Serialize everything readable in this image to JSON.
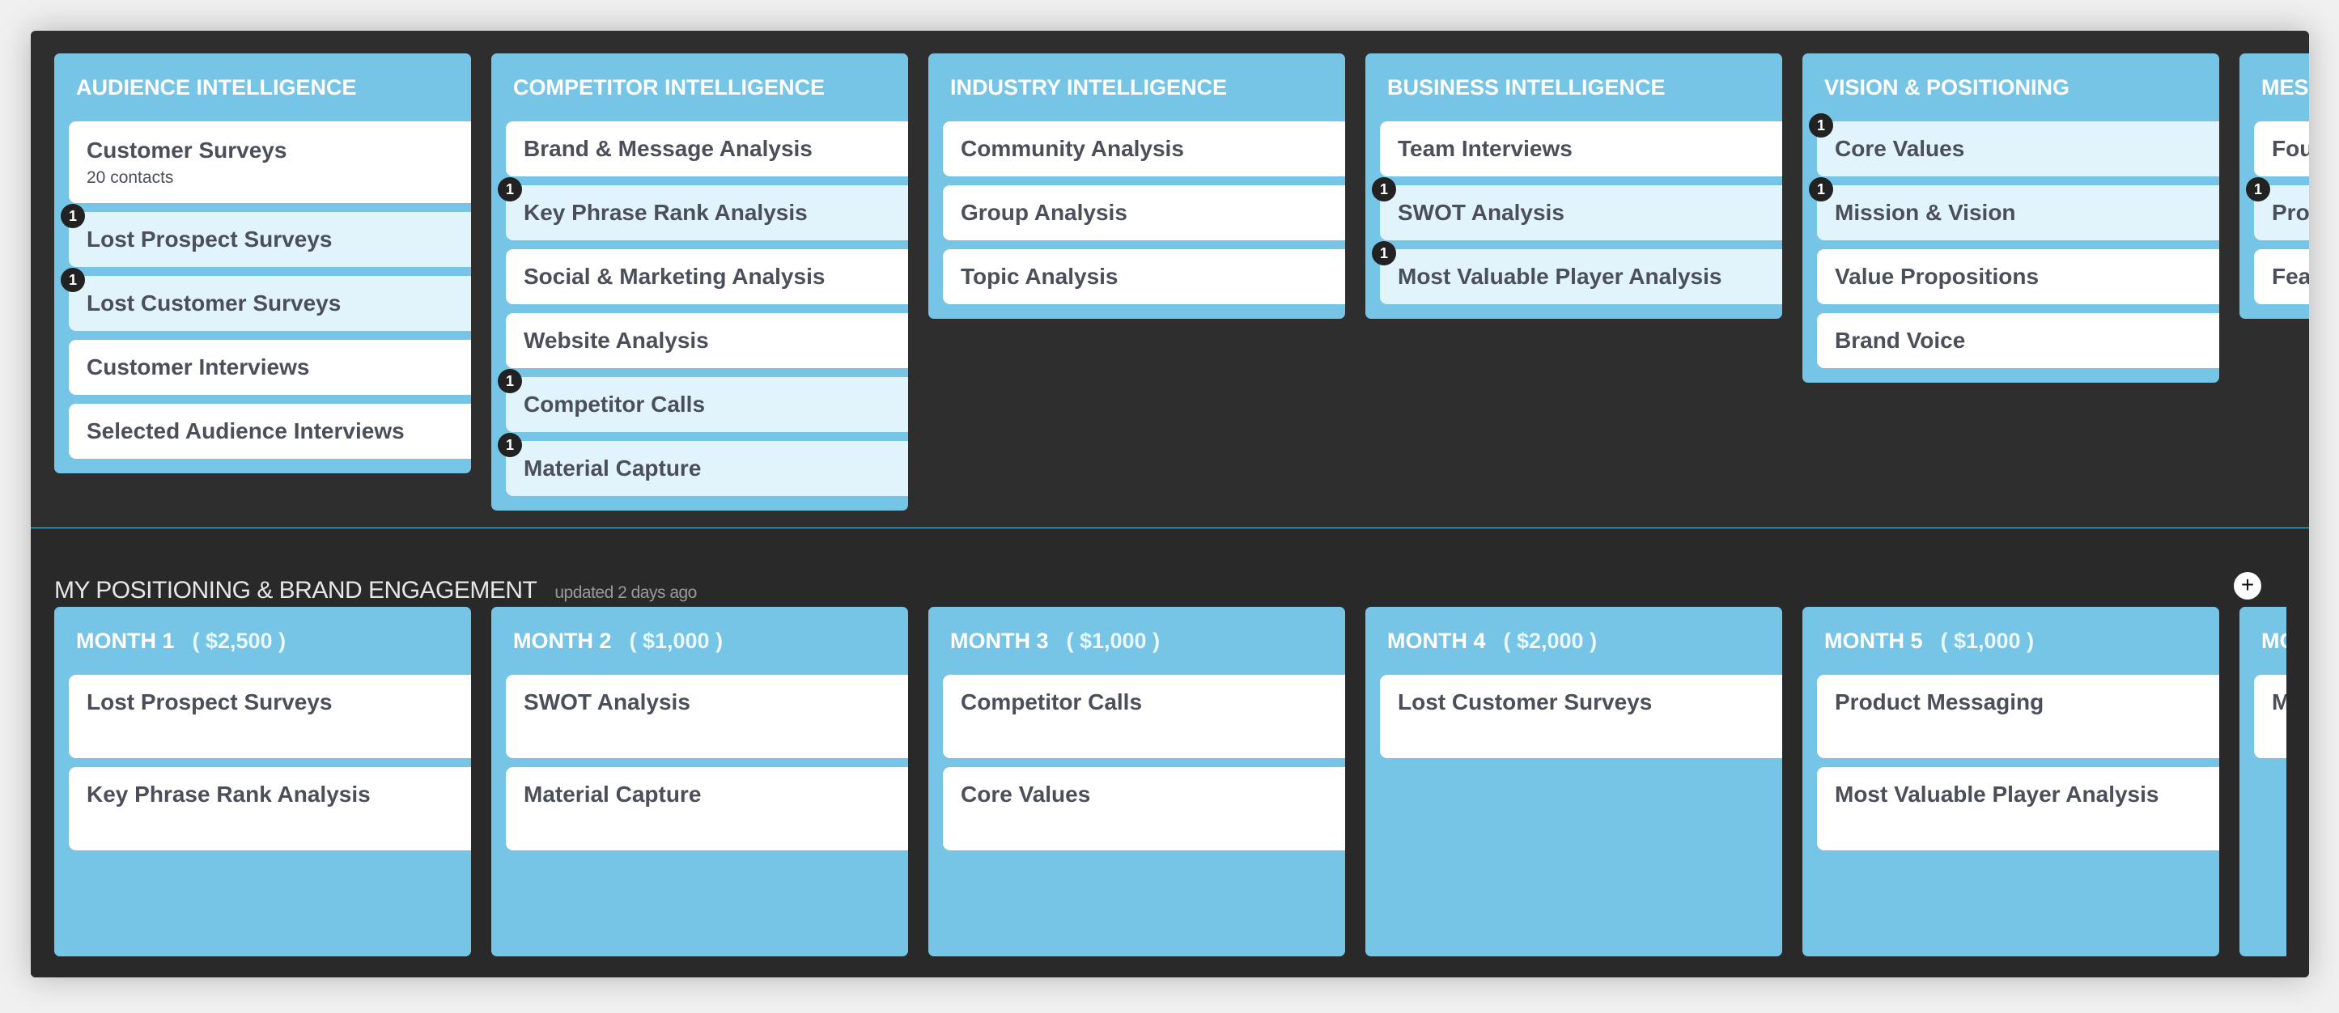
{
  "colors": {
    "column_bg": "#76c5e7",
    "item_bg": "#ffffff",
    "item_flagged_bg": "#e2f4fb",
    "panel_bg": "#2e2e2e",
    "text": "#4a4f5a",
    "badge_bg": "#222222"
  },
  "categories": [
    {
      "title": "AUDIENCE INTELLIGENCE",
      "items": [
        {
          "label": "Customer Surveys",
          "sub": "20 contacts",
          "badge": null
        },
        {
          "label": "Lost Prospect Surveys",
          "badge": "1"
        },
        {
          "label": "Lost Customer Surveys",
          "badge": "1"
        },
        {
          "label": "Customer Interviews",
          "badge": null
        },
        {
          "label": "Selected Audience Interviews",
          "badge": null
        }
      ]
    },
    {
      "title": "COMPETITOR INTELLIGENCE",
      "items": [
        {
          "label": "Brand & Message Analysis",
          "badge": null
        },
        {
          "label": "Key Phrase Rank Analysis",
          "badge": "1"
        },
        {
          "label": "Social & Marketing Analysis",
          "badge": null
        },
        {
          "label": "Website Analysis",
          "badge": null
        },
        {
          "label": "Competitor Calls",
          "badge": "1"
        },
        {
          "label": "Material Capture",
          "badge": "1"
        }
      ]
    },
    {
      "title": "INDUSTRY INTELLIGENCE",
      "items": [
        {
          "label": "Community Analysis",
          "badge": null
        },
        {
          "label": "Group Analysis",
          "badge": null
        },
        {
          "label": "Topic Analysis",
          "badge": null
        }
      ]
    },
    {
      "title": "BUSINESS INTELLIGENCE",
      "items": [
        {
          "label": "Team Interviews",
          "badge": null
        },
        {
          "label": "SWOT Analysis",
          "badge": "1"
        },
        {
          "label": "Most Valuable Player Analysis",
          "badge": "1"
        }
      ]
    },
    {
      "title": "VISION & POSITIONING",
      "items": [
        {
          "label": "Core Values",
          "badge": "1"
        },
        {
          "label": "Mission & Vision",
          "badge": "1"
        },
        {
          "label": "Value Propositions",
          "badge": null
        },
        {
          "label": "Brand Voice",
          "badge": null
        }
      ]
    },
    {
      "title": "MES",
      "items": [
        {
          "label": "Fou",
          "badge": null
        },
        {
          "label": "Pro",
          "badge": "1"
        },
        {
          "label": "Fea",
          "badge": null
        }
      ]
    }
  ],
  "engagement": {
    "title": "MY POSITIONING & BRAND ENGAGEMENT",
    "updated": "updated 2 days ago",
    "add_icon": "plus-icon",
    "months": [
      {
        "title": "MONTH 1",
        "amount": "( $2,500 )",
        "items": [
          "Lost Prospect Surveys",
          "Key Phrase Rank Analysis"
        ]
      },
      {
        "title": "MONTH 2",
        "amount": "( $1,000 )",
        "items": [
          "SWOT Analysis",
          "Material Capture"
        ]
      },
      {
        "title": "MONTH 3",
        "amount": "( $1,000 )",
        "items": [
          "Competitor Calls",
          "Core Values"
        ]
      },
      {
        "title": "MONTH 4",
        "amount": "( $2,000 )",
        "items": [
          "Lost Customer Surveys"
        ]
      },
      {
        "title": "MONTH 5",
        "amount": "( $1,000 )",
        "items": [
          "Product Messaging",
          "Most Valuable Player Analysis"
        ]
      },
      {
        "title": "MO",
        "amount": "",
        "items": [
          "M"
        ]
      }
    ]
  }
}
